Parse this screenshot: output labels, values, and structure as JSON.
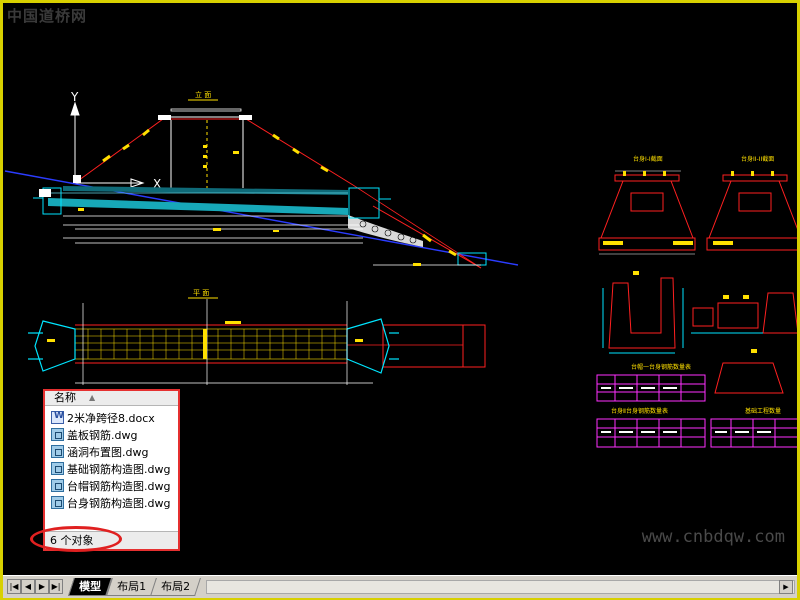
{
  "watermark": {
    "top_left": "中国道桥网",
    "bottom_right": "www.cnbdqw.com"
  },
  "file_panel": {
    "column_header": "名称",
    "items": [
      {
        "name": "2米净跨径8.docx",
        "icon": "word-doc-icon"
      },
      {
        "name": "盖板钢筋.dwg",
        "icon": "dwg-file-icon"
      },
      {
        "name": "涵洞布置图.dwg",
        "icon": "dwg-file-icon"
      },
      {
        "name": "基础钢筋构造图.dwg",
        "icon": "dwg-file-icon"
      },
      {
        "name": "台帽钢筋构造图.dwg",
        "icon": "dwg-file-icon"
      },
      {
        "name": "台身钢筋构造图.dwg",
        "icon": "dwg-file-icon"
      }
    ],
    "status": "6 个对象"
  },
  "tabs": [
    {
      "label": "模型",
      "active": true
    },
    {
      "label": "布局1",
      "active": false
    },
    {
      "label": "布局2",
      "active": false
    }
  ],
  "colors": {
    "frame": "#d8d000",
    "highlight": "#e02020",
    "cad_bg": "#000000"
  }
}
